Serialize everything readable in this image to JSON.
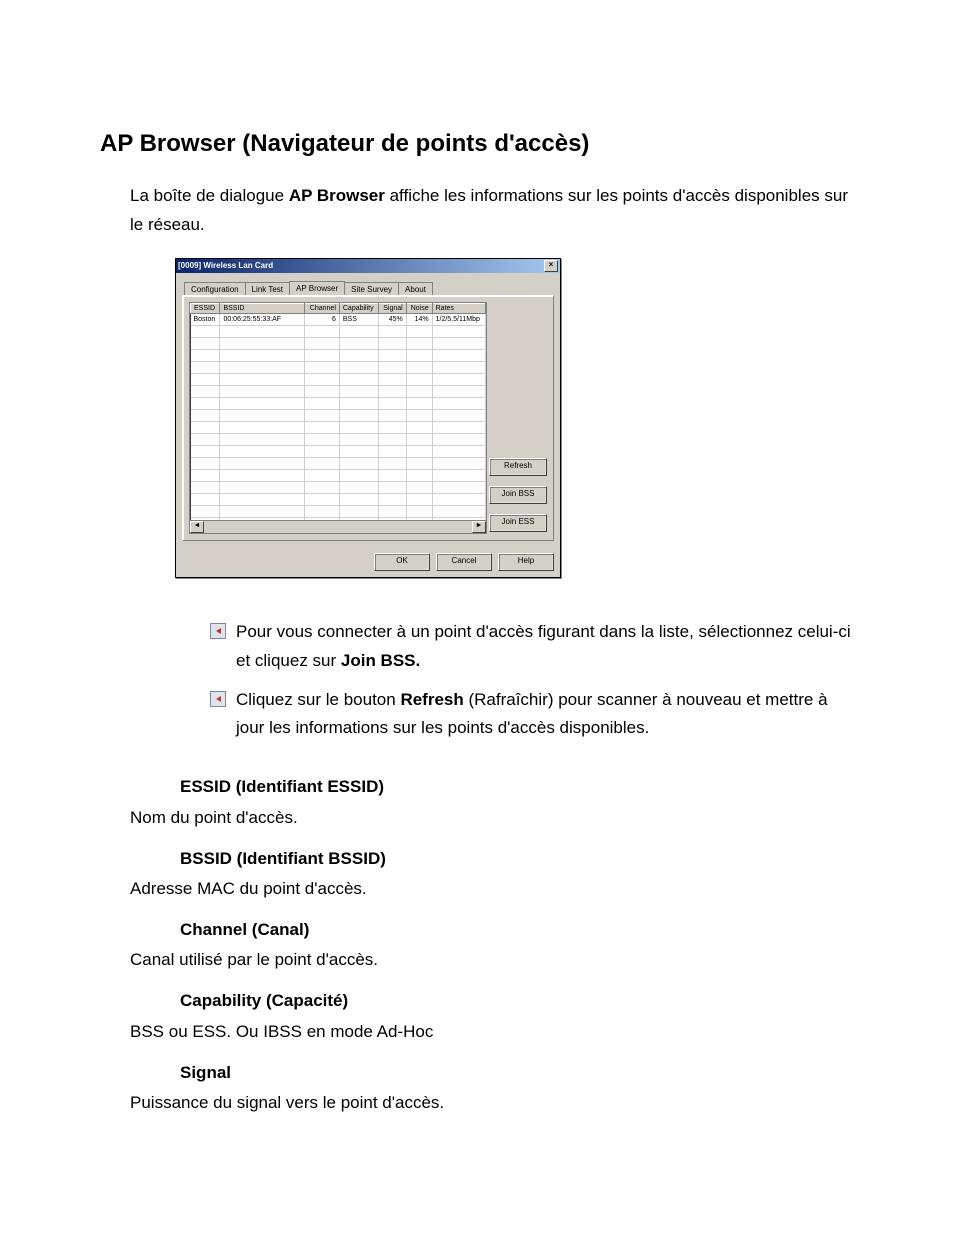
{
  "title": "AP Browser (Navigateur de points d'accès)",
  "intro_pre": "La boîte de dialogue ",
  "intro_bold": "AP Browser",
  "intro_post": " affiche les informations sur les points d'accès disponibles sur le réseau.",
  "dialog": {
    "title": "[0009] Wireless Lan Card",
    "close": "×",
    "tabs": [
      "Configuration",
      "Link Test",
      "AP Browser",
      "Site Survey",
      "About"
    ],
    "active_tab_index": 2,
    "columns": [
      "ESSID",
      "BSSID",
      "Channel",
      "Capability",
      "Signal",
      "Noise",
      "Rates"
    ],
    "rows": [
      {
        "essid": "Boston",
        "bssid": "00:06:25:55:33:AF",
        "channel": "6",
        "capability": "BSS",
        "signal": "45%",
        "noise": "14%",
        "rates": "1/2/5.5/11Mbp"
      }
    ],
    "side_buttons": [
      "Refresh",
      "Join BSS",
      "Join ESS"
    ],
    "bottom_buttons": [
      "OK",
      "Cancel",
      "Help"
    ],
    "scroll_left": "◄",
    "scroll_right": "►"
  },
  "bullets": [
    {
      "pre": "Pour vous connecter à un point d'accès figurant dans la liste, sélectionnez celui-ci et cliquez sur ",
      "bold": "Join BSS.",
      "post": ""
    },
    {
      "pre": "Cliquez sur le bouton ",
      "bold": "Refresh",
      "post": " (Rafraîchir) pour scanner à nouveau et mettre à jour les informations sur les points d'accès disponibles."
    }
  ],
  "defs": [
    {
      "term": "ESSID (Identifiant ESSID)",
      "desc": "Nom du point d'accès."
    },
    {
      "term": "BSSID (Identifiant BSSID)",
      "desc": "Adresse MAC du point d'accès."
    },
    {
      "term": "Channel (Canal)",
      "desc": "Canal utilisé par le point d'accès."
    },
    {
      "term": "Capability (Capacité)",
      "desc": "BSS ou ESS. Ou IBSS en mode Ad-Hoc"
    },
    {
      "term": "Signal",
      "desc": "Puissance du signal vers le point d'accès."
    }
  ]
}
